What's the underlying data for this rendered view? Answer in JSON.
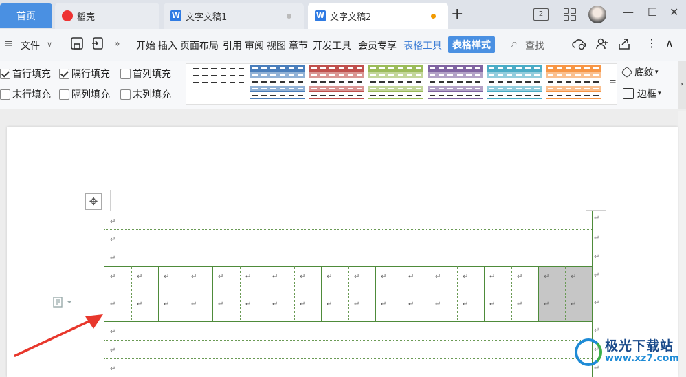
{
  "tabs": {
    "home": "首页",
    "daoke": "稻壳",
    "doc1": "文字文稿1",
    "doc2": "文字文稿2",
    "plus": "+",
    "w_glyph": "W"
  },
  "titlebar": {
    "badge": "2",
    "minimize": "—",
    "maximize": "☐",
    "close": "✕"
  },
  "toolbar": {
    "menu_icon": "≡",
    "file": "文件",
    "file_chevron": "∨",
    "more": "»",
    "start": "开始",
    "insert": "插入",
    "layout": "页面布局",
    "ref": "引用",
    "review": "审阅",
    "view": "视图",
    "chapter": "章节",
    "dev": "开发工具",
    "member": "会员专享",
    "table_tools": "表格工具",
    "table_style": "表格样式",
    "search": "查找",
    "search_icon": "⌕",
    "kebab": "⋮",
    "collapse": "∧"
  },
  "ribbon": {
    "first_row_fill": "首行填充",
    "alt_row_fill": "隔行填充",
    "first_col_fill": "首列填充",
    "last_row_fill": "末行填充",
    "alt_col_fill": "隔列填充",
    "last_col_fill": "末列填充",
    "first_row_checked": true,
    "alt_row_checked": true,
    "more_styles": "=",
    "shading": "底纹",
    "border": "边框",
    "dropdown_caret": "▾",
    "scroll_right": "›"
  },
  "style_colors": [
    "#333333",
    "#4a7ebb",
    "#c0504d",
    "#9bbb59",
    "#8064a2",
    "#4bacc6",
    "#f79646"
  ],
  "doc": {
    "para_mark": "↵",
    "move_glyph": "✥"
  },
  "watermark": {
    "name": "极光下载站",
    "url": "www.xz7.com"
  },
  "accent": "#4a90e2",
  "table_border": "#4e8b3a",
  "arrow_color": "#e8372c"
}
